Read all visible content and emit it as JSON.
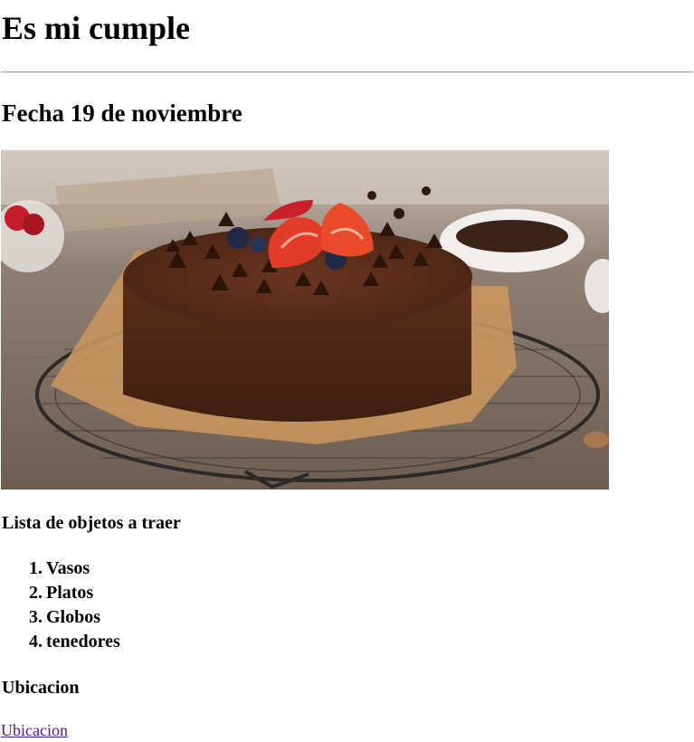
{
  "page": {
    "title": "Es mi cumple",
    "date": "Fecha 19 de noviembre"
  },
  "image": {
    "subject": "chocolate-cake-icon"
  },
  "list": {
    "heading": "Lista de objetos a traer",
    "items": [
      {
        "number": "1.",
        "label": "Vasos"
      },
      {
        "number": "2.",
        "label": "Platos"
      },
      {
        "number": "3.",
        "label": "Globos"
      },
      {
        "number": "4.",
        "label": "tenedores"
      }
    ]
  },
  "location": {
    "heading": "Ubicacion",
    "link_text": "Ubicacion"
  },
  "colors": {
    "visited_link": "#551a8b",
    "rule": "#9a9a9a"
  }
}
